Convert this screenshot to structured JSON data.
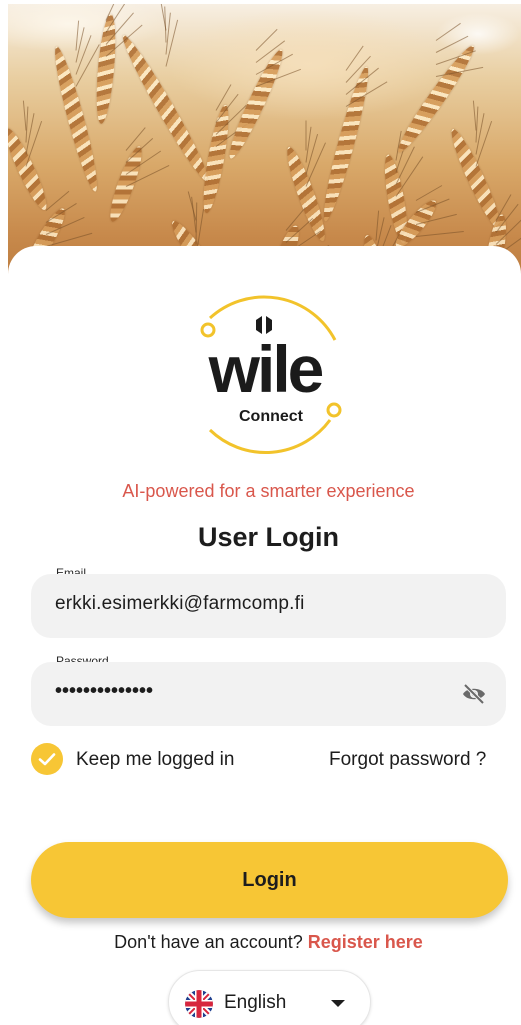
{
  "brand": {
    "logo_word": "wile",
    "logo_sub": "Connect",
    "tagline": "AI-powered for a smarter experience"
  },
  "login": {
    "title": "User Login",
    "email_label": "Email",
    "email_value": "erkki.esimerkki@farmcomp.fi",
    "password_label": "Password",
    "password_value": "••••••••••••••",
    "keep_logged_in": "Keep me logged in",
    "keep_logged_in_checked": true,
    "forgot_password": "Forgot password ?",
    "login_button": "Login",
    "no_account_text": "Don't have an account?",
    "register_link": "Register here"
  },
  "language": {
    "selected": "English"
  },
  "icons": {
    "password_toggle": "eye-off-icon",
    "checkbox": "check-icon",
    "flag": "uk-flag-icon",
    "dropdown": "caret-down-icon"
  },
  "colors": {
    "accent": "#f7c635",
    "link_red": "#d9574c",
    "field_bg": "#f2f2f2",
    "text": "#1d1d1d"
  }
}
